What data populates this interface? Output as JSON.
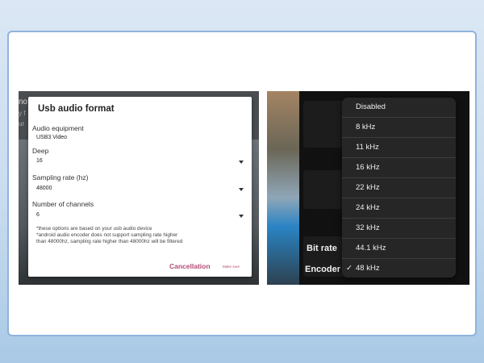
{
  "left_panel": {
    "bg_text1": "no",
    "bg_text2": "y f",
    "bg_text3": "ur",
    "dialog": {
      "title": "Usb audio format",
      "equipment_label": "Audio equipment",
      "equipment_value": "USB3 Video",
      "deep_label": "Deep",
      "deep_value": "16",
      "sampling_label": "Sampling rate (hz)",
      "sampling_value": "48000",
      "channels_label": "Number of channels",
      "channels_value": "6",
      "note1": "*these options are based on your usb audio device",
      "note2": "*android audio encoder does not support sampling rate higher",
      "note3": "than 48000hz, sampling rate higher than 48000hz will be filtered",
      "cancel_label": "Cancellation",
      "confirm_label": "Make sure"
    }
  },
  "right_panel": {
    "bitrate_label": "Bit rate",
    "encoder_label": "Encoder",
    "menu_items": [
      "Disabled",
      "8 kHz",
      "11 kHz",
      "16 kHz",
      "22 kHz",
      "24 kHz",
      "32 kHz",
      "44.1 kHz",
      "48 kHz"
    ],
    "selected_index": 8,
    "check_glyph": "✓"
  },
  "colors": {
    "accent": "#b44a76",
    "frame_border": "#8fb3de",
    "menu_bg": "#262626"
  }
}
